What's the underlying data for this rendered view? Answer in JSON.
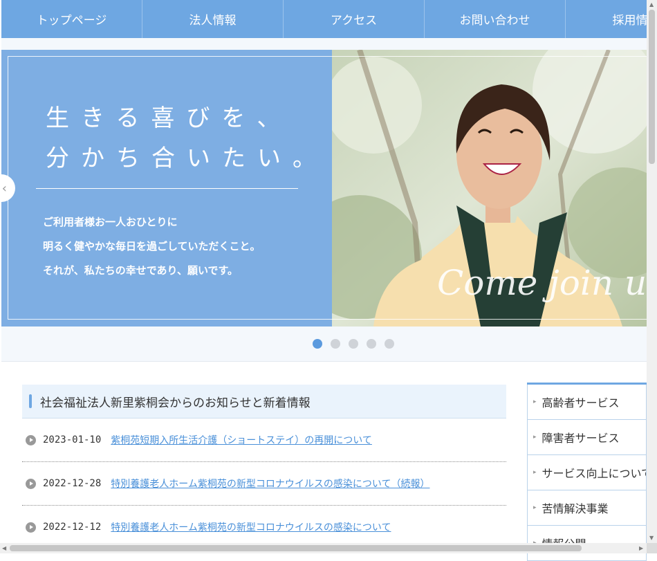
{
  "nav": {
    "items": [
      "トップページ",
      "法人情報",
      "アクセス",
      "お問い合わせ",
      "採用情報"
    ]
  },
  "hero": {
    "title_line1": "生きる喜びを、",
    "title_line2": "分かち合いたい。",
    "body_line1": "ご利用者様お一人おひとりに",
    "body_line2": "明るく健やかな毎日を過ごしていただくこと。",
    "body_line3": "それが、私たちの幸せであり、願いです。",
    "script_text": "Come join us",
    "prev_arrow": "‹",
    "active_slide": 1,
    "slide_count": 5
  },
  "news": {
    "heading": "社会福祉法人新里紫桐会からのお知らせと新着情報",
    "items": [
      {
        "date": "2023-01-10",
        "title": "紫桐苑短期入所生活介護（ショートステイ）の再開について"
      },
      {
        "date": "2022-12-28",
        "title": "特別養護老人ホーム紫桐苑の新型コロナウイルスの感染について（続報）"
      },
      {
        "date": "2022-12-12",
        "title": "特別養護老人ホーム紫桐苑の新型コロナウイルスの感染について"
      }
    ]
  },
  "side_menu": {
    "items": [
      "高齢者サービス",
      "障害者サービス",
      "サービス向上について",
      "苦情解決事業",
      "情報公開"
    ]
  },
  "colors": {
    "accent": "#6ea7e2",
    "hero_bg": "#7eaee3",
    "link": "#4a90d9",
    "dot_active": "#5b9ade"
  }
}
